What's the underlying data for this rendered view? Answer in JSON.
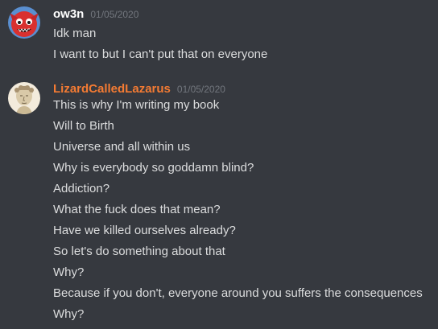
{
  "messages": [
    {
      "author": "ow3n",
      "timestamp": "01/05/2020",
      "author_color": "#ffffff",
      "avatar": "red-creature-avatar-icon",
      "lines": [
        "Idk man",
        "I want to but I can't put that on everyone"
      ]
    },
    {
      "author": "LizardCalledLazarus",
      "timestamp": "01/05/2020",
      "author_color": "#f47b33",
      "avatar": "statue-bust-avatar-icon",
      "lines": [
        "This is why I'm writing my book",
        "Will to Birth",
        "Universe and all within us",
        "Why is everybody so goddamn blind?",
        "Addiction?",
        "What the fuck does that mean?",
        "Have we killed ourselves already?",
        "So let's do something about that",
        "Why?",
        "Because if you don't, everyone around you suffers the consequences",
        "Why?"
      ]
    }
  ]
}
